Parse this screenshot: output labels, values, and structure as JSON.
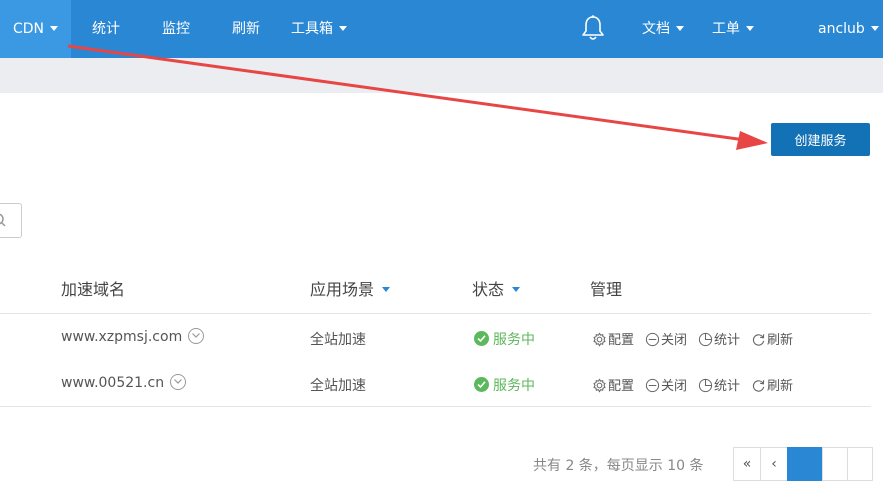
{
  "nav": {
    "cdn": "CDN",
    "stats": "统计",
    "monitor": "监控",
    "refresh": "刷新",
    "toolbox": "工具箱",
    "docs": "文档",
    "tickets": "工单",
    "user": "anclub"
  },
  "create_button": "创建服务",
  "table": {
    "headers": {
      "domain": "加速域名",
      "scene": "应用场景",
      "status": "状态",
      "manage": "管理"
    },
    "rows": [
      {
        "domain": "www.xzpmsj.com",
        "scene": "全站加速",
        "status": "服务中"
      },
      {
        "domain": "www.00521.cn",
        "scene": "全站加速",
        "status": "服务中"
      }
    ],
    "actions": {
      "config": "配置",
      "close": "关闭",
      "stats": "统计",
      "refresh": "刷新"
    }
  },
  "pager": {
    "info": "共有 2 条，每页显示 10 条",
    "first": "«",
    "prev": "‹"
  },
  "colors": {
    "nav_bg": "#2a87d4",
    "button": "#1272b5",
    "status_ok": "#5cb85c",
    "arrow": "#e84545"
  }
}
